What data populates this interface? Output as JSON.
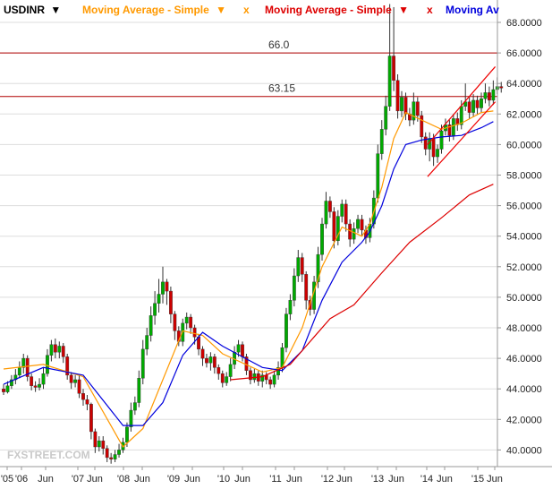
{
  "legend": {
    "symbol": "USDINR",
    "symbol_arrow": "▼",
    "ma1": "Moving Average - Simple",
    "ma1_arrow": "▼",
    "x1": "x",
    "ma2": "Moving Average - Simple",
    "ma2_arrow": "▼",
    "x2": "x",
    "ma3": "Moving Av"
  },
  "watermark": "FXSTREET.COM",
  "colors": {
    "up": "#00aa00",
    "down": "#cc0000",
    "wick": "#333333",
    "ma_orange": "#ff9900",
    "ma_blue": "#0000dd",
    "ma_red": "#dd0000",
    "level_line": "#b00000",
    "channel": "#ee0000",
    "grid": "#dddddd"
  },
  "chart_data": {
    "type": "candlestick",
    "title": "USDINR",
    "ylim": [
      39.0,
      69.2
    ],
    "y_ticks": [
      "40.0000",
      "42.0000",
      "44.0000",
      "46.0000",
      "48.0000",
      "50.0000",
      "52.0000",
      "54.0000",
      "56.0000",
      "58.0000",
      "60.0000",
      "62.0000",
      "64.0000",
      "66.0000",
      "68.0000"
    ],
    "x_ticks": [
      "'05",
      "'06",
      "Jun",
      "'07",
      "Jun",
      "'08",
      "Jun",
      "'09",
      "Jun",
      "'10",
      "Jun",
      "'11",
      "Jun",
      "'12",
      "Jun",
      "'13",
      "Jun",
      "'14",
      "Jun",
      "'15",
      "Jun"
    ],
    "levels": [
      {
        "label": "66.0",
        "value": 66.0
      },
      {
        "label": "63.15",
        "value": 63.15
      }
    ],
    "candles": [
      [
        44.0,
        43.8,
        44.3,
        43.6
      ],
      [
        43.8,
        44.2,
        44.5,
        43.7
      ],
      [
        44.2,
        44.6,
        44.9,
        44.0
      ],
      [
        44.6,
        44.9,
        45.3,
        44.3
      ],
      [
        44.9,
        45.4,
        45.8,
        44.7
      ],
      [
        45.4,
        46.0,
        46.3,
        45.0
      ],
      [
        46.0,
        44.8,
        46.2,
        44.5
      ],
      [
        44.8,
        44.2,
        45.0,
        43.9
      ],
      [
        44.2,
        44.1,
        44.5,
        43.8
      ],
      [
        44.1,
        44.3,
        44.7,
        43.9
      ],
      [
        44.3,
        45.0,
        45.4,
        44.0
      ],
      [
        45.0,
        46.2,
        46.6,
        44.8
      ],
      [
        46.2,
        46.9,
        47.2,
        45.8
      ],
      [
        46.9,
        46.4,
        47.3,
        46.0
      ],
      [
        46.4,
        46.8,
        47.1,
        46.0
      ],
      [
        46.8,
        46.1,
        47.0,
        45.7
      ],
      [
        46.1,
        44.9,
        46.3,
        44.6
      ],
      [
        44.9,
        44.4,
        45.1,
        44.0
      ],
      [
        44.4,
        44.6,
        44.9,
        44.1
      ],
      [
        44.6,
        43.7,
        44.9,
        43.4
      ],
      [
        43.7,
        43.3,
        44.0,
        42.9
      ],
      [
        43.3,
        43.0,
        43.6,
        42.6
      ],
      [
        43.0,
        41.2,
        43.1,
        40.7
      ],
      [
        41.2,
        40.2,
        41.4,
        39.8
      ],
      [
        40.2,
        40.6,
        40.9,
        39.9
      ],
      [
        40.6,
        40.1,
        40.9,
        39.7
      ],
      [
        40.1,
        39.5,
        40.3,
        39.2
      ],
      [
        39.5,
        39.4,
        39.8,
        39.1
      ],
      [
        39.4,
        39.7,
        40.0,
        39.2
      ],
      [
        39.7,
        40.0,
        40.4,
        39.5
      ],
      [
        40.0,
        40.5,
        40.8,
        39.8
      ],
      [
        40.5,
        41.5,
        41.8,
        40.2
      ],
      [
        41.5,
        42.6,
        43.1,
        41.2
      ],
      [
        42.6,
        43.1,
        43.5,
        42.3
      ],
      [
        43.1,
        44.7,
        45.2,
        42.8
      ],
      [
        44.7,
        46.6,
        47.2,
        44.3
      ],
      [
        46.6,
        47.5,
        48.0,
        46.2
      ],
      [
        47.5,
        48.8,
        49.4,
        47.1
      ],
      [
        48.8,
        49.6,
        50.4,
        48.2
      ],
      [
        49.6,
        50.2,
        51.2,
        49.0
      ],
      [
        50.2,
        51.0,
        52.0,
        49.6
      ],
      [
        51.0,
        50.4,
        51.2,
        49.5
      ],
      [
        50.4,
        48.9,
        50.7,
        48.3
      ],
      [
        48.9,
        47.8,
        49.1,
        47.2
      ],
      [
        47.8,
        47.1,
        48.1,
        46.8
      ],
      [
        47.1,
        48.3,
        48.6,
        46.8
      ],
      [
        48.3,
        48.7,
        49.0,
        47.9
      ],
      [
        48.7,
        48.0,
        48.9,
        47.6
      ],
      [
        48.0,
        47.4,
        48.2,
        46.9
      ],
      [
        47.4,
        46.6,
        47.6,
        46.2
      ],
      [
        46.6,
        46.0,
        46.8,
        45.5
      ],
      [
        46.0,
        45.7,
        46.3,
        45.4
      ],
      [
        45.7,
        46.1,
        46.4,
        45.2
      ],
      [
        46.1,
        45.4,
        46.3,
        45.0
      ],
      [
        45.4,
        45.0,
        45.6,
        44.6
      ],
      [
        45.0,
        44.4,
        45.2,
        44.1
      ],
      [
        44.4,
        44.8,
        45.1,
        44.2
      ],
      [
        44.8,
        45.6,
        46.0,
        44.5
      ],
      [
        45.6,
        46.4,
        46.8,
        45.3
      ],
      [
        46.4,
        46.9,
        47.2,
        46.1
      ],
      [
        46.9,
        46.1,
        47.1,
        45.8
      ],
      [
        46.1,
        45.2,
        46.3,
        44.9
      ],
      [
        45.2,
        44.6,
        45.4,
        44.3
      ],
      [
        44.6,
        45.0,
        45.3,
        44.4
      ],
      [
        45.0,
        44.5,
        45.2,
        44.2
      ],
      [
        44.5,
        44.9,
        45.2,
        44.1
      ],
      [
        44.9,
        44.6,
        45.1,
        44.3
      ],
      [
        44.6,
        44.3,
        44.8,
        44.0
      ],
      [
        44.3,
        44.9,
        45.2,
        44.1
      ],
      [
        44.9,
        45.4,
        45.8,
        44.6
      ],
      [
        45.4,
        46.7,
        47.0,
        45.1
      ],
      [
        46.7,
        48.9,
        49.3,
        46.4
      ],
      [
        48.9,
        49.8,
        50.2,
        48.5
      ],
      [
        49.8,
        51.4,
        51.9,
        49.4
      ],
      [
        51.4,
        52.6,
        53.1,
        51.0
      ],
      [
        52.6,
        51.5,
        52.9,
        51.0
      ],
      [
        51.5,
        49.8,
        51.7,
        49.2
      ],
      [
        49.8,
        49.2,
        50.1,
        48.8
      ],
      [
        49.2,
        51.0,
        51.4,
        48.9
      ],
      [
        51.0,
        52.8,
        53.3,
        50.6
      ],
      [
        52.8,
        54.8,
        55.2,
        52.4
      ],
      [
        54.8,
        56.3,
        56.9,
        54.5
      ],
      [
        56.3,
        55.6,
        56.6,
        55.2
      ],
      [
        55.6,
        53.7,
        55.9,
        53.2
      ],
      [
        53.7,
        55.3,
        55.7,
        53.4
      ],
      [
        55.3,
        56.1,
        56.4,
        54.9
      ],
      [
        56.1,
        54.8,
        56.4,
        54.3
      ],
      [
        54.8,
        53.8,
        55.1,
        53.3
      ],
      [
        53.8,
        54.5,
        54.9,
        53.5
      ],
      [
        54.5,
        55.1,
        55.4,
        54.2
      ],
      [
        55.1,
        54.4,
        55.4,
        54.0
      ],
      [
        54.4,
        53.9,
        54.7,
        53.5
      ],
      [
        53.9,
        54.8,
        55.2,
        53.6
      ],
      [
        54.8,
        56.5,
        57.0,
        54.5
      ],
      [
        56.5,
        59.4,
        60.0,
        56.2
      ],
      [
        59.4,
        61.0,
        61.6,
        59.0
      ],
      [
        61.0,
        62.5,
        63.2,
        60.6
      ],
      [
        62.5,
        65.8,
        69.2,
        62.2
      ],
      [
        65.8,
        64.2,
        69.0,
        63.5
      ],
      [
        64.2,
        62.2,
        64.6,
        61.7
      ],
      [
        62.2,
        63.1,
        63.5,
        61.8
      ],
      [
        63.1,
        62.0,
        63.4,
        61.6
      ],
      [
        62.0,
        61.6,
        62.4,
        61.2
      ],
      [
        61.6,
        62.8,
        63.4,
        61.3
      ],
      [
        62.8,
        61.9,
        63.1,
        61.5
      ],
      [
        61.9,
        60.5,
        62.2,
        60.1
      ],
      [
        60.5,
        59.7,
        60.8,
        59.3
      ],
      [
        59.7,
        60.4,
        60.8,
        58.9
      ],
      [
        60.4,
        59.2,
        60.7,
        58.6
      ],
      [
        59.2,
        59.7,
        60.0,
        58.8
      ],
      [
        59.7,
        60.9,
        61.3,
        59.4
      ],
      [
        60.9,
        61.3,
        61.7,
        60.6
      ],
      [
        61.3,
        60.6,
        61.6,
        60.2
      ],
      [
        60.6,
        61.7,
        62.0,
        60.3
      ],
      [
        61.7,
        61.3,
        62.1,
        60.9
      ],
      [
        61.3,
        62.5,
        62.9,
        61.0
      ],
      [
        62.5,
        62.8,
        64.0,
        62.2
      ],
      [
        62.8,
        62.1,
        63.1,
        61.7
      ],
      [
        62.1,
        62.9,
        63.3,
        61.8
      ],
      [
        62.9,
        62.4,
        63.2,
        62.0
      ],
      [
        62.4,
        63.0,
        63.4,
        62.1
      ],
      [
        63.0,
        63.4,
        64.0,
        62.7
      ],
      [
        63.4,
        62.9,
        63.8,
        62.5
      ],
      [
        62.9,
        63.6,
        64.2,
        62.6
      ],
      [
        63.6,
        63.8,
        64.4,
        63.3
      ],
      [
        63.8,
        63.7,
        64.1,
        63.4
      ]
    ],
    "series": [
      {
        "color": "orange",
        "x": [
          0,
          10,
          20,
          30,
          35,
          40,
          45,
          50,
          55,
          60,
          65,
          70,
          75,
          80,
          85,
          90,
          92,
          95,
          98,
          101,
          105,
          110,
          115,
          120,
          123
        ],
        "values": [
          45.3,
          45.6,
          44.8,
          40.2,
          41.4,
          44.6,
          47.8,
          47.5,
          46.3,
          45.7,
          45.1,
          45.4,
          48.0,
          52.0,
          54.6,
          54.0,
          54.8,
          57.2,
          60.4,
          62.1,
          61.6,
          61.0,
          61.4,
          62.1,
          62.2
        ]
      },
      {
        "color": "blue",
        "x": [
          0,
          10,
          20,
          30,
          35,
          40,
          45,
          50,
          55,
          60,
          65,
          70,
          75,
          80,
          85,
          90,
          92,
          95,
          98,
          101,
          105,
          110,
          115,
          120,
          123
        ],
        "values": [
          44.3,
          45.4,
          44.9,
          41.6,
          41.6,
          43.1,
          46.2,
          47.7,
          46.8,
          46.1,
          45.4,
          45.2,
          46.5,
          49.8,
          52.3,
          53.6,
          54.3,
          56.0,
          58.4,
          60.0,
          60.3,
          60.5,
          60.6,
          61.1,
          61.5
        ]
      },
      {
        "color": "red",
        "x": [
          57,
          65,
          72,
          78,
          82,
          88,
          95,
          102,
          110,
          117,
          123
        ],
        "values": [
          44.6,
          44.8,
          45.6,
          47.4,
          48.6,
          49.5,
          51.6,
          53.6,
          55.2,
          56.7,
          57.4
        ]
      }
    ],
    "channel": [
      {
        "x": [
          106.5,
          123.5
        ],
        "values": [
          60.0,
          65.1
        ]
      },
      {
        "x": [
          106.5,
          123.5
        ],
        "values": [
          57.9,
          62.8
        ]
      }
    ]
  }
}
